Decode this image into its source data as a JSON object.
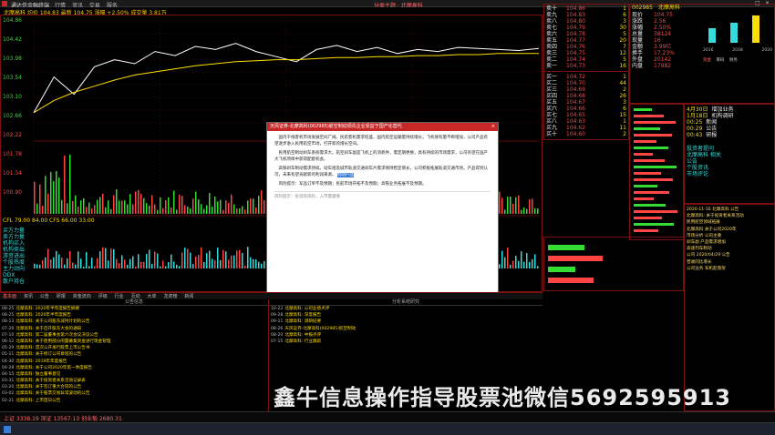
{
  "titlebar": {
    "app_name": "通达信金融终端",
    "menu": [
      "行情",
      "资讯",
      "交易",
      "服务"
    ],
    "center_text": "分类主题 · 北摩高科",
    "window_controls": [
      "minimize-icon",
      "maximize-icon",
      "close-icon"
    ]
  },
  "infoline": {
    "text": "北摩高科 均价 104.83  最新 104.75  涨幅 +2.50%  成交量 3.81万"
  },
  "chart": {
    "price_axis_left": [
      "104.86",
      "104.42",
      "103.98",
      "103.54",
      "103.10",
      "102.66",
      "102.22",
      "101.78",
      "101.34",
      "100.90"
    ],
    "volume_label": "CFL 79.00  84.00  CFS 66.00  33.00",
    "time_ticks": [
      "09:30",
      "10:30",
      "13:00",
      "14:00",
      "15:00"
    ],
    "price_line": [
      0.1,
      0.45,
      0.28,
      0.55,
      0.62,
      0.58,
      0.7,
      0.66,
      0.75,
      0.72,
      0.78,
      0.7,
      0.65,
      0.6,
      0.72,
      0.76,
      0.7,
      0.74,
      0.68,
      0.72,
      0.7,
      0.74,
      0.73,
      0.72,
      0.71,
      0.73
    ],
    "avg_line": [
      0.1,
      0.22,
      0.3,
      0.36,
      0.42,
      0.47,
      0.5,
      0.53,
      0.56,
      0.58,
      0.6,
      0.61,
      0.62,
      0.62,
      0.63,
      0.64,
      0.64,
      0.65,
      0.65,
      0.66,
      0.66,
      0.67,
      0.67,
      0.68,
      0.68,
      0.68
    ],
    "left_labels": [
      "买方力量",
      "卖方力量",
      "机构买入",
      "机构卖出",
      "游资进出",
      "个股热度",
      "主力动向",
      "DDX",
      "散户持仓"
    ]
  },
  "orderbook": {
    "sell": [
      {
        "label": "卖十",
        "price": "104.86",
        "vol": "1"
      },
      {
        "label": "卖九",
        "price": "104.83",
        "vol": "6"
      },
      {
        "label": "卖八",
        "price": "104.80",
        "vol": "3"
      },
      {
        "label": "卖七",
        "price": "104.79",
        "vol": "30"
      },
      {
        "label": "卖六",
        "price": "104.78",
        "vol": "5"
      },
      {
        "label": "卖五",
        "price": "104.77",
        "vol": "20"
      },
      {
        "label": "卖四",
        "price": "104.76",
        "vol": "7"
      },
      {
        "label": "卖三",
        "price": "104.75",
        "vol": "12"
      },
      {
        "label": "卖二",
        "price": "104.74",
        "vol": "5"
      },
      {
        "label": "卖一",
        "price": "104.73",
        "vol": "16"
      }
    ],
    "buy": [
      {
        "label": "买一",
        "price": "104.72",
        "vol": "1"
      },
      {
        "label": "买二",
        "price": "104.70",
        "vol": "44"
      },
      {
        "label": "买三",
        "price": "104.69",
        "vol": "2"
      },
      {
        "label": "买四",
        "price": "104.68",
        "vol": "26"
      },
      {
        "label": "买五",
        "price": "104.67",
        "vol": "3"
      },
      {
        "label": "买六",
        "price": "104.66",
        "vol": "6"
      },
      {
        "label": "买七",
        "price": "104.65",
        "vol": "15"
      },
      {
        "label": "买八",
        "price": "104.63",
        "vol": "1"
      },
      {
        "label": "买九",
        "price": "104.62",
        "vol": "11"
      },
      {
        "label": "买十",
        "price": "104.60",
        "vol": "2"
      }
    ]
  },
  "quote": {
    "code": "002985",
    "name": "北摩高科",
    "rows": [
      {
        "k": "现价",
        "v": "104.75"
      },
      {
        "k": "涨跌",
        "v": "2.56"
      },
      {
        "k": "涨幅",
        "v": "2.50%"
      },
      {
        "k": "总量",
        "v": "38124"
      },
      {
        "k": "现量",
        "v": "16"
      },
      {
        "k": "金额",
        "v": "3.99亿"
      },
      {
        "k": "换手",
        "v": "17.23%"
      },
      {
        "k": "外盘",
        "v": "20142"
      },
      {
        "k": "内盘",
        "v": "17982"
      }
    ],
    "years": [
      "2016",
      "2018",
      "2020"
    ],
    "tabs": [
      "资金",
      "筹码",
      "财务"
    ]
  },
  "info_list": [
    {
      "k": "4月30日",
      "v": "增加业务"
    },
    {
      "k": "1月18日",
      "v": "机构调研"
    },
    {
      "k": "00:25",
      "v": "新闻"
    },
    {
      "k": "00:29",
      "v": "公告"
    },
    {
      "k": "00:43",
      "v": "研报"
    }
  ],
  "right_news": [
    "2020-11-16 北摩高科 公告",
    "北摩高科: 关于投资者关系活动",
    "民用航空领域拓展",
    "北摩高科 关于公司2020年",
    "市场分析 公司主要",
    "刹车副 产品需求增加",
    "高速列车制动",
    "公司 2020/04/29 公告",
    "营收同比增长",
    "公司业务 军机起落架"
  ],
  "side_right": [
    "投资者提问",
    "北摩高科 相关",
    "公告",
    "个股资讯",
    "市场评论"
  ],
  "popup": {
    "title": "天风证券-北摩高科(002985)航空制动领先企业受益于国产化替代",
    "paragraphs": [
      "国内干线客机市场发展空间广阔。民航客机需求旺盛，国内航空运输量持续增长，飞机保有量不断增加，公司产品有望逐步进入民用航空市场，打开新的增长空间。",
      "民用航空制动刹车系统需求大。航空刹车副是飞机上的消耗件，需定期更换，具有持续的市场需求，公司有望在国产大飞机项目中获得配套机会。",
      "高铁刹车制动需求持续。动车组及城市轨道交通刹车片需求保持稳定增长，公司积极拓展轨道交通市场，产品得到认可，未来有望贡献新的利润来源。",
      "风险提示：军品订单不及预期；民航市场开拓不及预期；高铁业务拓展不及预期。"
    ],
    "highlight": "制动产品",
    "footer": "风险提示：投资有风险，入市需谨慎"
  },
  "tabs": [
    "基本面",
    "资讯",
    "公告",
    "研报",
    "资金流向",
    "评级",
    "行业",
    "互动",
    "大单",
    "龙虎榜",
    "新闻"
  ],
  "news_left": {
    "header": "公告信息",
    "items": [
      {
        "d": "08-25",
        "t": "北摩高科: 2020年半年度报告摘要"
      },
      {
        "d": "08-25",
        "t": "北摩高科: 2020年半年度报告"
      },
      {
        "d": "08-13",
        "t": "北摩高科: 关于公司股东减持计划的公告"
      },
      {
        "d": "07-29",
        "t": "北摩高科: 关于召开股东大会的通知"
      },
      {
        "d": "07-10",
        "t": "北摩高科: 第二届董事会第六次会议决议公告"
      },
      {
        "d": "06-12",
        "t": "北摩高科: 关于使用部分闲置募集资金进行现金管理"
      },
      {
        "d": "05-29",
        "t": "北摩高科: 首次公开发行股票上市公告书"
      },
      {
        "d": "05-11",
        "t": "北摩高科: 关于修订公司章程的公告"
      },
      {
        "d": "04-30",
        "t": "北摩高科: 2019年年度报告"
      },
      {
        "d": "04-28",
        "t": "北摩高科: 关于公司2020年第一季度报告"
      },
      {
        "d": "04-15",
        "t": "北摩高科: 独立董事意见"
      },
      {
        "d": "03-31",
        "t": "北摩高科: 关于投资者关系活动记录表"
      },
      {
        "d": "03-20",
        "t": "北摩高科: 关于签订重大合同的公告"
      },
      {
        "d": "03-02",
        "t": "北摩高科: 关于股票交易异常波动的公告"
      },
      {
        "d": "02-21",
        "t": "北摩高科: 上市首日公告"
      }
    ]
  },
  "news_right": {
    "header": "分析系统研究",
    "items": [
      {
        "d": "10-22",
        "t": "北摩高科: 公司业绩点评"
      },
      {
        "d": "09-28",
        "t": "北摩高科: 深度报告"
      },
      {
        "d": "09-11",
        "t": "北摩高科: 调研纪要"
      },
      {
        "d": "08-26",
        "t": "天风证券-北摩高科(002985)航空制动"
      },
      {
        "d": "08-20",
        "t": "北摩高科: 中报点评"
      },
      {
        "d": "07-15",
        "t": "北摩高科: 行业跟踪"
      }
    ]
  },
  "statusbar": {
    "text": "上证 3338.19  深证 13567.13  创业板 2680.31"
  },
  "watermark": "鑫牛信息操作指导股票池微信5692595913"
}
